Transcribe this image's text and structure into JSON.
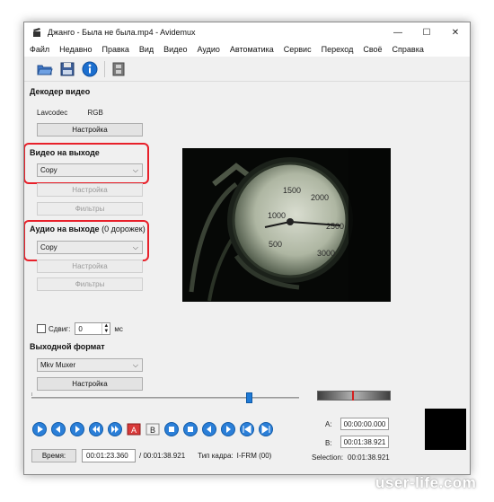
{
  "window": {
    "title": "Джанго - Была не была.mp4 - Avidemux",
    "controls": {
      "minimize": "—",
      "maximize": "☐",
      "close": "✕"
    }
  },
  "menu": [
    "Файл",
    "Недавно",
    "Правка",
    "Вид",
    "Видео",
    "Аудио",
    "Автоматика",
    "Сервис",
    "Переход",
    "Своё",
    "Справка"
  ],
  "toolbar": {
    "icons": [
      "open-folder-icon",
      "save-disk-icon",
      "info-icon",
      "film-strip-icon"
    ]
  },
  "decoder": {
    "title": "Декодер видео",
    "codec": "Lavcodec",
    "format": "RGB",
    "config_button": "Настройка"
  },
  "video_output": {
    "title": "Видео на выходе",
    "selected": "Copy",
    "config_button": "Настройка",
    "filters_button": "Фильтры"
  },
  "audio_output": {
    "title": "Аудио на выходе",
    "tracks": "(0 дорожек)",
    "selected": "Copy",
    "config_button": "Настройка",
    "filters_button": "Фильтры"
  },
  "shift": {
    "label": "Сдвиг:",
    "value": "0",
    "unit": "мс"
  },
  "output_format": {
    "title": "Выходной формат",
    "selected": "Mkv Muxer",
    "config_button": "Настройка"
  },
  "player": {
    "slider_position": 0.82,
    "a_label": "A:",
    "a_value": "00:00:00.000",
    "b_label": "B:",
    "b_value": "00:01:38.921",
    "selection_label": "Selection:",
    "selection_value": "00:01:38.921",
    "time_button": "Время:",
    "current_time": "00:01:23.360",
    "total_time": "/ 00:01:38.921",
    "frame_type_label": "Тип кадра:",
    "frame_type_value": "I-FRM (00)",
    "nav_icons": [
      "play-icon",
      "rewind-icon",
      "fast-forward-icon",
      "prev-frame-icon",
      "next-frame-icon",
      "set-marker-a-icon",
      "set-marker-b-icon",
      "prev-black-icon",
      "next-black-icon",
      "prev-keyframe-icon",
      "next-keyframe-icon",
      "goto-start-icon",
      "goto-end-icon"
    ]
  },
  "watermark": "user-life.com",
  "colors": {
    "accent": "#1f7ad6",
    "highlight": "#e8202a"
  }
}
